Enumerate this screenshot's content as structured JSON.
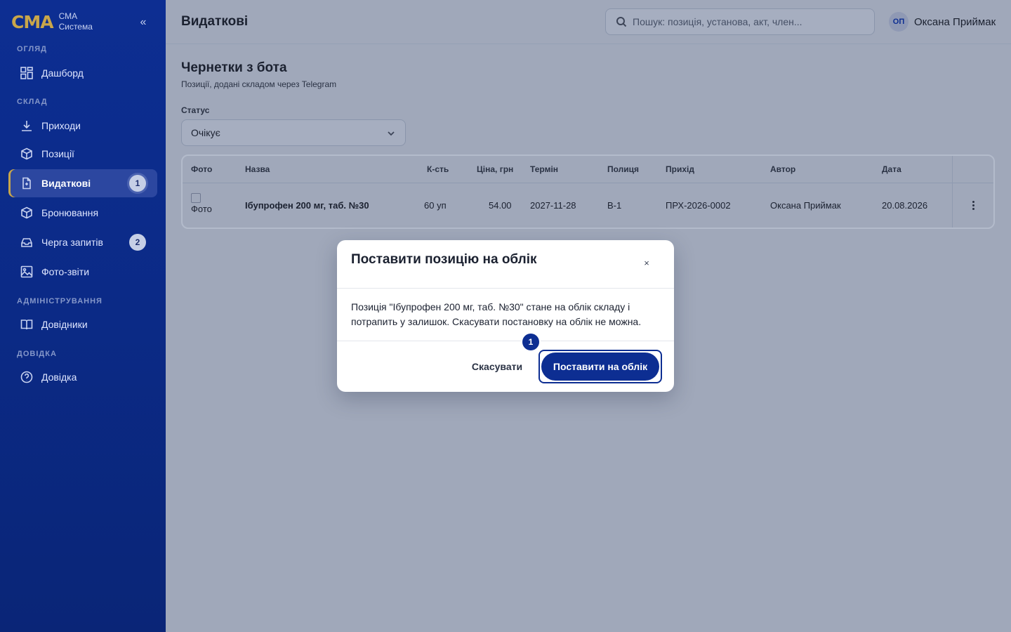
{
  "brand": {
    "logo": "CMA",
    "line1": "СМА",
    "line2": "Система",
    "collapse": "«"
  },
  "sidebar": {
    "sections": [
      {
        "label": "ОГЛЯД"
      },
      {
        "label": "СКЛАД"
      },
      {
        "label": "АДМІНІСТРУВАННЯ"
      },
      {
        "label": "ДОВІДКА"
      }
    ],
    "items": [
      {
        "label": "Дашборд",
        "icon": "dashboard-icon"
      },
      {
        "label": "Приходи",
        "icon": "download-icon"
      },
      {
        "label": "Позиції",
        "icon": "box-icon"
      },
      {
        "label": "Видаткові",
        "icon": "document-icon",
        "badge": "1",
        "active": true
      },
      {
        "label": "Бронювання",
        "icon": "box-icon"
      },
      {
        "label": "Черга запитів",
        "icon": "inbox-icon",
        "badge": "2"
      },
      {
        "label": "Фото-звіти",
        "icon": "image-icon"
      },
      {
        "label": "Довідники",
        "icon": "book-icon"
      },
      {
        "label": "Довідка",
        "icon": "help-icon"
      }
    ]
  },
  "header": {
    "title": "Видаткові",
    "search_placeholder": "Пошук: позиція, установа, акт, член...",
    "user_initials": "ОП",
    "user_name": "Оксана Приймак"
  },
  "main": {
    "title": "Чернетки з бота",
    "subtitle": "Позиції, додані складом через Telegram",
    "status_label": "Статус",
    "status_value": "Очікує",
    "table": {
      "columns": [
        "Фото",
        "Назва",
        "К-сть",
        "Ціна, грн",
        "Термін",
        "Полиця",
        "Прихід",
        "Автор",
        "Дата"
      ],
      "rows": [
        {
          "photo_alt": "Фото",
          "name": "Ібупрофен 200 мг, таб. №30",
          "qty": "60 уп",
          "price": "54.00",
          "term": "2027-11-28",
          "shelf": "В-1",
          "receipt": "ПРХ-2026-0002",
          "author": "Оксана Приймак",
          "date": "20.08.2026"
        }
      ]
    }
  },
  "modal": {
    "title": "Поставити позицію на облік",
    "close": "×",
    "body": "Позиція \"Ібупрофен 200 мг, таб. №30\" стане на облік складу і потрапить у залишок. Скасувати постановку на облік не можна.",
    "cancel_label": "Скасувати",
    "confirm_label": "Поставити на облік",
    "step_marker": "1"
  },
  "colors": {
    "sidebar": "#0d2e92",
    "accent": "#c9a64a",
    "primary": "#0d2e92",
    "overlay": "#a0a8ba"
  }
}
